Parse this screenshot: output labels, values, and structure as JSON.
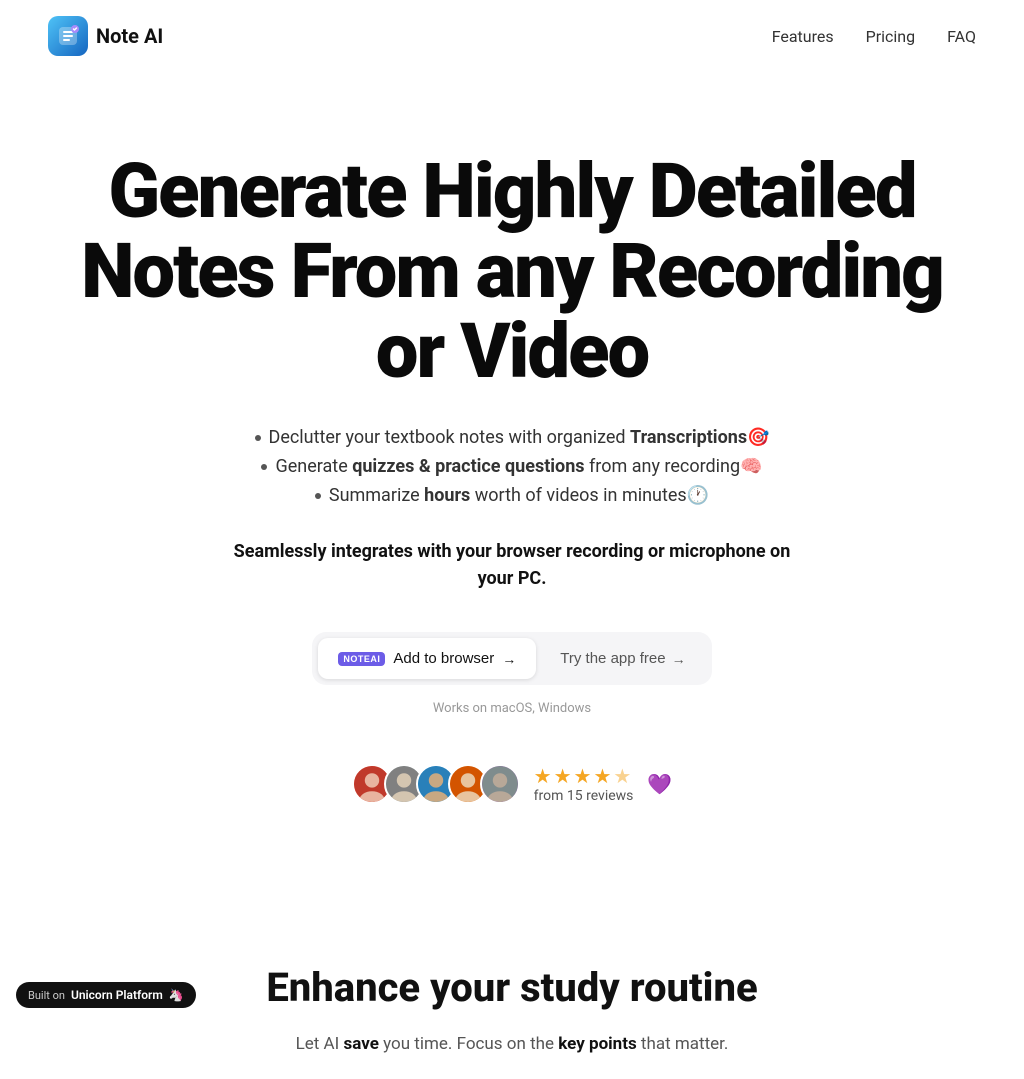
{
  "nav": {
    "logo_text": "Note AI",
    "links": [
      {
        "label": "Features",
        "id": "features"
      },
      {
        "label": "Pricing",
        "id": "pricing"
      },
      {
        "label": "FAQ",
        "id": "faq"
      }
    ]
  },
  "hero": {
    "title": "Generate Highly Detailed Notes From any Recording or Video",
    "bullets": [
      {
        "text_before": "Declutter your textbook notes with organized ",
        "bold": "Transcriptions🎯",
        "text_after": ""
      },
      {
        "text_before": "Generate ",
        "bold": "quizzes & practice questions",
        "text_after": " from any recording🧠"
      },
      {
        "text_before": "Summarize ",
        "bold": "hours",
        "text_after": " worth of videos in minutes🕐"
      }
    ],
    "subtitle": "Seamlessly integrates with your browser recording or microphone on your PC.",
    "cta_add_browser": "Add to browser",
    "cta_try_free": "Try the app free",
    "platform_note": "Works on macOS, Windows"
  },
  "reviews": {
    "stars": 4.5,
    "star_count": 4,
    "review_count": "from 15 reviews"
  },
  "enhance": {
    "title": "Enhance your study routine",
    "desc_before": "Let AI ",
    "desc_bold1": "save",
    "desc_middle": " you time. Focus on the ",
    "desc_bold2": "key points",
    "desc_after": " that matter."
  },
  "built_on": {
    "label": "Built on",
    "platform": "Unicorn Platform"
  },
  "icons": {
    "arrow": "→",
    "heart": "💜",
    "star_filled": "★",
    "star_empty": "☆"
  }
}
